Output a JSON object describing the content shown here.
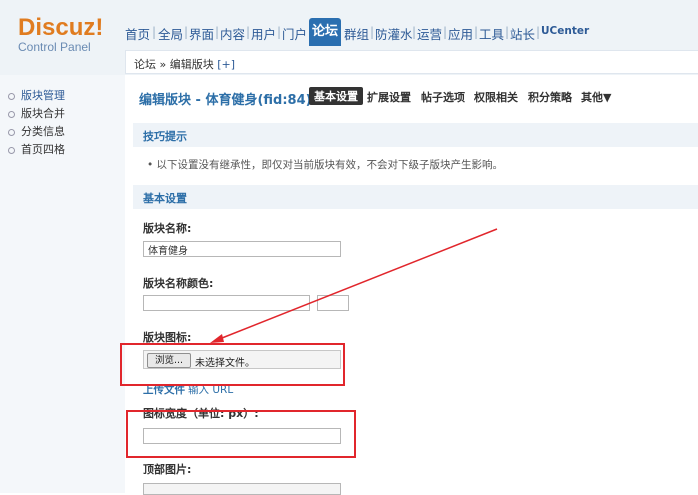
{
  "header": {
    "brand": "Discuz!",
    "subtitle": "Control Panel",
    "nav": [
      "首页",
      "全局",
      "界面",
      "内容",
      "用户",
      "门户",
      "论坛",
      "群组",
      "防灌水",
      "运营",
      "应用",
      "工具",
      "站长",
      "UCenter"
    ],
    "active_nav": "论坛",
    "breadcrumb": "论坛 » 编辑版块",
    "breadcrumb_add": "[+]"
  },
  "sidebar": {
    "items": [
      {
        "label": "版块管理",
        "active": true
      },
      {
        "label": "版块合并",
        "active": false
      },
      {
        "label": "分类信息",
        "active": false
      },
      {
        "label": "首页四格",
        "active": false
      }
    ]
  },
  "main": {
    "title": "编辑版块 - 体育健身(fid:84)",
    "tabs": [
      "基本设置",
      "扩展设置",
      "帖子选项",
      "权限相关",
      "积分策略",
      "其他▼"
    ],
    "tip_header": "技巧提示",
    "tip_text": "• 以下设置没有继承性，即仅对当前版块有效，不会对下级子版块产生影响。",
    "basic_header": "基本设置",
    "fields": {
      "name_label": "版块名称:",
      "name_value": "体育健身",
      "color_label": "版块名称颜色:",
      "icon_label": "版块图标:",
      "browse_button": "浏览...",
      "file_status": "未选择文件。",
      "upload_link": "上传文件",
      "url_link": "输入 URL",
      "width_label": "图标宽度（单位: px）:",
      "top_image_label": "顶部图片:"
    }
  },
  "annotation_color": "#e1262c"
}
